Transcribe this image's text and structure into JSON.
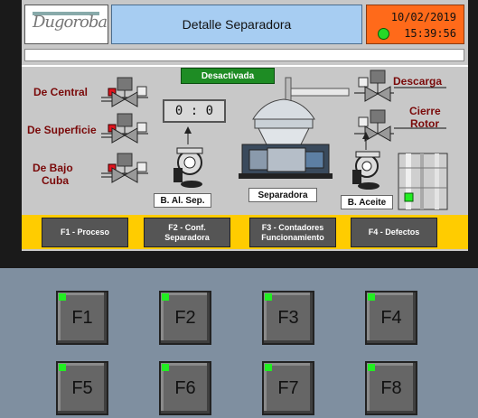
{
  "header": {
    "logo_text": "Dugoroba",
    "title": "Detalle Separadora",
    "date": "10/02/2019",
    "time": "15:39:56"
  },
  "status": {
    "label": "Desactivada",
    "color": "#1e8c24"
  },
  "counter": {
    "value": "0 :   0"
  },
  "inlets": {
    "de_central": "De Central",
    "de_superficie": "De Superficie",
    "de_bajo_cuba_line1": "De Bajo",
    "de_bajo_cuba_line2": "Cuba"
  },
  "outlets": {
    "descarga": "Descarga",
    "cierre_rotor_line1": "Cierre",
    "cierre_rotor_line2": "Rotor"
  },
  "equipment": {
    "bomba_separadora": "B. Al. Sep.",
    "separadora": "Separadora",
    "bomba_aceite": "B. Aceite"
  },
  "function_buttons": [
    {
      "label": "F1 - Proceso"
    },
    {
      "label": "F2 - Conf.\nSeparadora"
    },
    {
      "label": "F3 - Contadores\nFuncionamiento"
    },
    {
      "label": "F4 - Defectos"
    }
  ],
  "keys": [
    "F1",
    "F2",
    "F3",
    "F4",
    "F5",
    "F6",
    "F7",
    "F8"
  ],
  "colors": {
    "title_bg": "#a7cdf2",
    "clock_bg": "#ff6a1a",
    "fbar_bg": "#ffcc00",
    "valve_active": "#e0141e",
    "key_led": "#22ee22"
  }
}
